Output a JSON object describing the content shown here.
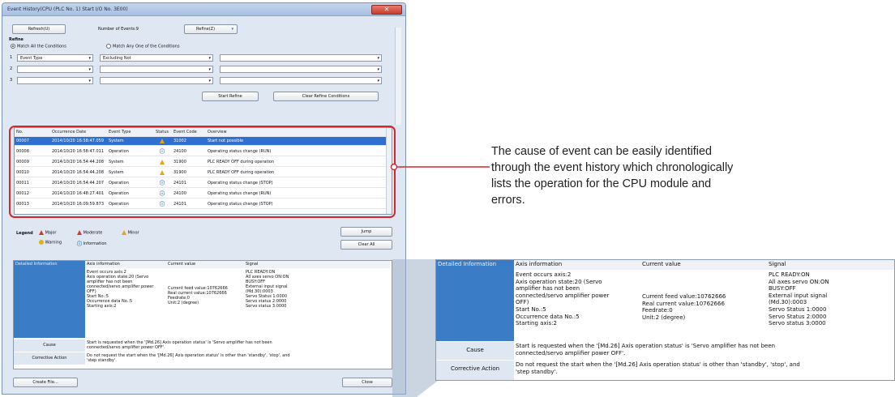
{
  "window": {
    "title": "Event History(CPU (PLC No. 1) Start I/O No. 3E00)",
    "close_glyph": "✕"
  },
  "toolbar": {
    "refresh_label": "Refresh(U)",
    "count_label": "Number of Events:9",
    "refine_label": "Refine(Z)",
    "refine_arrow": "▾"
  },
  "refine": {
    "group_label": "Refine",
    "match_all": "Match All the Conditions",
    "match_any": "Match Any One of the Conditions",
    "rows": [
      {
        "num": "1",
        "field": "Event Type",
        "op": "Excluding Not",
        "value": ""
      },
      {
        "num": "2",
        "field": "",
        "op": "",
        "value": ""
      },
      {
        "num": "3",
        "field": "",
        "op": "",
        "value": ""
      }
    ],
    "start_button": "Start Refine",
    "clear_button": "Clear Refine Conditions"
  },
  "table": {
    "columns": [
      "No.",
      "Occurrence Date",
      "Event Type",
      "Status",
      "Event Code",
      "Overview"
    ],
    "rows": [
      {
        "no": "00007",
        "date": "2014/10/20 16:58:47.059",
        "type": "System",
        "status": "moderate",
        "code": "31002",
        "overview": "Start not possible",
        "selected": true
      },
      {
        "no": "00008",
        "date": "2014/10/20 16:58:47.011",
        "type": "Operation",
        "status": "info",
        "code": "24100",
        "overview": "Operating status change (RUN)",
        "selected": false
      },
      {
        "no": "00009",
        "date": "2014/10/20 16:54:44.208",
        "type": "System",
        "status": "moderate",
        "code": "31900",
        "overview": "PLC READY OFF during operation",
        "selected": false
      },
      {
        "no": "00010",
        "date": "2014/10/20 16:54:44.208",
        "type": "System",
        "status": "moderate",
        "code": "31900",
        "overview": "PLC READY OFF during operation",
        "selected": false
      },
      {
        "no": "00011",
        "date": "2014/10/20 16:54:44.207",
        "type": "Operation",
        "status": "info",
        "code": "24101",
        "overview": "Operating status change (STOP)",
        "selected": false
      },
      {
        "no": "00012",
        "date": "2014/10/20 16:48:27.401",
        "type": "Operation",
        "status": "info",
        "code": "24100",
        "overview": "Operating status change (RUN)",
        "selected": false
      },
      {
        "no": "00013",
        "date": "2014/10/20 16:09:59.873",
        "type": "Operation",
        "status": "info",
        "code": "24101",
        "overview": "Operating status change (STOP)",
        "selected": false
      }
    ]
  },
  "legend": {
    "label": "Legend",
    "major": "Major",
    "moderate": "Moderate",
    "minor": "Minor",
    "warning": "Warning",
    "information": "Information"
  },
  "side_buttons": {
    "jump": "Jump",
    "clear_all": "Clear All"
  },
  "details": {
    "header": "Detailed Information",
    "col_axis": "Axis information",
    "col_current": "Current value",
    "col_signal": "Signal",
    "axis_lines": [
      "Event occurs axis:2",
      "Axis operation state:20 (Servo",
      "amplifier has not been",
      "connected/servo amplifier power",
      "OFF)",
      "Start No.:5",
      "Occurrence data No.:5",
      "Starting axis:2"
    ],
    "current_lines": [
      "Current feed value:10762666",
      "Real current value:10762666",
      "Feedrate:0",
      "Unit:2 (degree)"
    ],
    "signal_lines": [
      "PLC READY:ON",
      "All axes servo ON:ON",
      "BUSY:OFF",
      "External input signal",
      "(Md.30):0003",
      "Servo Status 1:0000",
      "Servo status 2:0000",
      "Servo status 3:0000"
    ],
    "cause_label": "Cause",
    "cause_lines": [
      "Start is requested when the '[Md.26] Axis operation status' is 'Servo amplifier has not been",
      "connected/servo amplifier power OFF'."
    ],
    "action_label": "Corrective Action",
    "action_lines": [
      "Do not request the start when the '[Md.26] Axis operation status' is other than 'standby', 'stop', and",
      "'step standby'."
    ]
  },
  "footer": {
    "create_file": "Create File...",
    "close": "Close"
  },
  "zoom": {
    "header": "Detailed Information",
    "col_axis": "Axis information",
    "col_current": "Current value",
    "col_signal": "Signal",
    "axis_lines": [
      "Event occurs axis:2",
      "Axis operation state:20 (Servo",
      "amplifier has not been",
      "connected/servo amplifier power",
      "OFF)",
      "Start No.:5",
      "Occurrence data No.:5",
      "Starting axis:2"
    ],
    "current_lines": [
      "Current feed value:10762666",
      "Real current value:10762666",
      "Feedrate:0",
      "Unit:2 (degree)"
    ],
    "signal_lines": [
      "PLC READY:ON",
      "All axes servo ON:ON",
      "BUSY:OFF",
      "External input signal",
      "(Md.30):0003",
      "Servo Status 1:0000",
      "Servo Status 2:0000",
      "Servo status 3:0000"
    ],
    "cause_label": "Cause",
    "cause_lines": [
      "Start is requested when the '[Md.26] Axis operation status' is 'Servo amplifier has not been",
      "connected/servo amplifier power OFF'."
    ],
    "action_label": "Corrective Action",
    "action_lines": [
      "Do not request the start when the '[Md.26] Axis operation status' is other than 'standby', 'stop', and",
      "'step standby'."
    ]
  },
  "description": "The cause of event can be easily identified through the event history which chronologically lists the operation for the CPU module and errors.",
  "colors": {
    "highlight": "#d2282b",
    "selection": "#2e6fd0",
    "detail_header": "#3b7cc7"
  }
}
